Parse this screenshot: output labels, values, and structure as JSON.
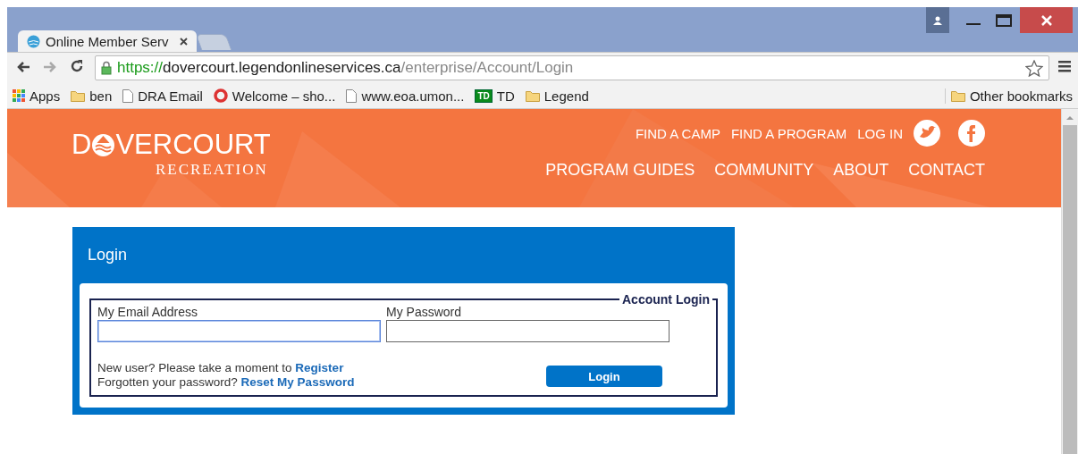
{
  "browser": {
    "tabs": [
      {
        "title": "Online Member Serv",
        "selected": true
      },
      {
        "selected": false
      }
    ],
    "url": {
      "scheme": "https://",
      "host": "dovercourt.legendonlineservices.ca",
      "path": "/enterprise/Account/Login"
    },
    "bookmarks": [
      {
        "kind": "apps",
        "label": "Apps"
      },
      {
        "kind": "folder",
        "label": "ben"
      },
      {
        "kind": "page",
        "label": "DRA Email"
      },
      {
        "kind": "ring",
        "label": "Welcome – sho..."
      },
      {
        "kind": "page",
        "label": "www.eoa.umon..."
      },
      {
        "kind": "td",
        "label": "TD",
        "badge": "TD"
      },
      {
        "kind": "folder",
        "label": "Legend"
      }
    ],
    "other_bookmarks": "Other bookmarks"
  },
  "site": {
    "logo": {
      "before": "D",
      "after": "VERCOURT",
      "subtitle": "RECREATION"
    },
    "top_links": [
      "FIND A CAMP",
      "FIND A PROGRAM",
      "LOG IN"
    ],
    "main_nav": [
      "PROGRAM GUIDES",
      "COMMUNITY",
      "ABOUT",
      "CONTACT"
    ]
  },
  "login": {
    "title": "Login",
    "legend": "Account Login",
    "fields": [
      {
        "label": "My Email Address",
        "focused": true
      },
      {
        "label": "My Password",
        "focused": false
      }
    ],
    "register_text": "New user? Please take a moment to ",
    "register_link": "Register",
    "reset_text": "Forgotten your password? ",
    "reset_link": "Reset My Password",
    "button": "Login"
  }
}
